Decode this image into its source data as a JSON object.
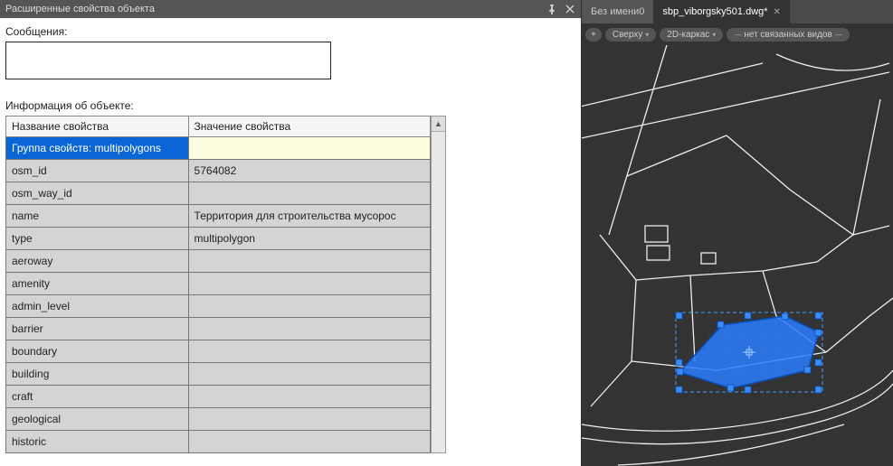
{
  "panel": {
    "title": "Расширенные свойства объекта",
    "messages_label": "Сообщения:",
    "object_info_label": "Информация об объекте:",
    "headers": {
      "name": "Название свойства",
      "value": "Значение свойства"
    },
    "group_row": {
      "label": "Группа свойств: multipolygons",
      "value": ""
    },
    "rows": [
      {
        "name": "osm_id",
        "value": "5764082"
      },
      {
        "name": "osm_way_id",
        "value": ""
      },
      {
        "name": "name",
        "value": "Территория для строительства мусорос"
      },
      {
        "name": "type",
        "value": "multipolygon"
      },
      {
        "name": "aeroway",
        "value": ""
      },
      {
        "name": "amenity",
        "value": ""
      },
      {
        "name": "admin_level",
        "value": ""
      },
      {
        "name": "barrier",
        "value": ""
      },
      {
        "name": "boundary",
        "value": ""
      },
      {
        "name": "building",
        "value": ""
      },
      {
        "name": "craft",
        "value": ""
      },
      {
        "name": "geological",
        "value": ""
      },
      {
        "name": "historic",
        "value": ""
      }
    ]
  },
  "tabs": {
    "inactive": "Без имени0",
    "active": "sbp_viborgsky501.dwg*"
  },
  "view_controls": {
    "plus": "+",
    "view1": "Сверху",
    "view2": "2D-каркас",
    "view3": "нет связанных видов"
  }
}
